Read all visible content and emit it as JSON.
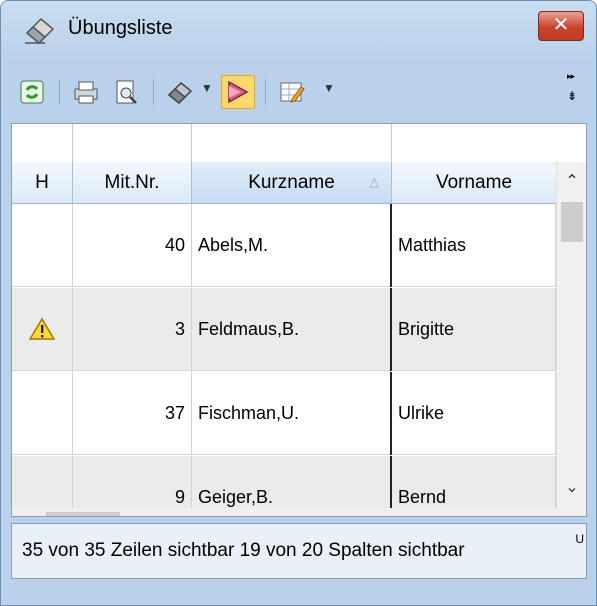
{
  "window": {
    "title": "Übungsliste",
    "close_label": "✕"
  },
  "toolbar": {
    "items": [
      "refresh-icon",
      "print-icon",
      "print-preview-icon",
      "tools-icon",
      "filter-icon",
      "table-edit-icon"
    ],
    "overflow_label": "▸▸"
  },
  "grid": {
    "columns": [
      {
        "key": "h",
        "label": "H"
      },
      {
        "key": "nr",
        "label": "Mit.Nr."
      },
      {
        "key": "kurz",
        "label": "Kurzname",
        "sorted": "asc"
      },
      {
        "key": "vor",
        "label": "Vorname"
      }
    ],
    "sort_indicator": "△",
    "rows": [
      {
        "warning": false,
        "nr": "40",
        "kurz": "Abels,M.",
        "vor": "Matthias"
      },
      {
        "warning": true,
        "nr": "3",
        "kurz": "Feldmaus,B.",
        "vor": "Brigitte"
      },
      {
        "warning": false,
        "nr": "37",
        "kurz": "Fischman,U.",
        "vor": "Ulrike"
      },
      {
        "warning": false,
        "nr": "9",
        "kurz": "Geiger,B.",
        "vor": "Bernd"
      }
    ]
  },
  "scrollbars": {
    "up": "⌃",
    "down": "⌄",
    "left": "<",
    "right": ">"
  },
  "status": {
    "text": "35 von 35 Zeilen sichtbar   19 von 20 Spalten sichtbar",
    "more": "U"
  }
}
